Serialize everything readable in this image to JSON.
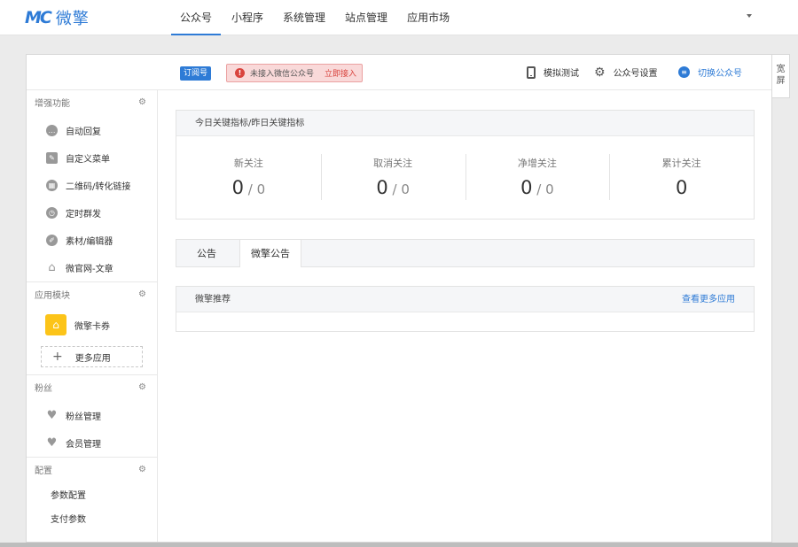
{
  "header": {
    "logo_mark": "MC",
    "logo_text": "微擎",
    "nav": [
      "公众号",
      "小程序",
      "系统管理",
      "站点管理",
      "应用市场"
    ]
  },
  "toolbar": {
    "badge": "订阅号",
    "alert_text": "未接入微信公众号",
    "alert_link": "立即接入",
    "simulate": "模拟测试",
    "settings": "公众号设置",
    "switch": "切换公众号"
  },
  "wide_tab": {
    "line1": "宽",
    "line2": "屏"
  },
  "sidebar": {
    "sections": [
      {
        "title": "增强功能",
        "items": [
          "自动回复",
          "自定义菜单",
          "二维码/转化链接",
          "定时群发",
          "素材/编辑器",
          "微官网-文章"
        ]
      },
      {
        "title": "应用模块",
        "card": "微擎卡券",
        "more": "更多应用"
      },
      {
        "title": "粉丝",
        "items": [
          "粉丝管理",
          "会员管理"
        ]
      },
      {
        "title": "配置",
        "items": [
          "参数配置",
          "支付参数"
        ]
      }
    ]
  },
  "stats_panel": {
    "title": "今日关键指标/昨日关键指标",
    "stats": [
      {
        "label": "新关注",
        "today": "0",
        "yesterday": "0"
      },
      {
        "label": "取消关注",
        "today": "0",
        "yesterday": "0"
      },
      {
        "label": "净增关注",
        "today": "0",
        "yesterday": "0"
      },
      {
        "label": "累计关注",
        "value": "0"
      }
    ]
  },
  "tabs": [
    "公告",
    "微擎公告"
  ],
  "recommend": {
    "title": "微擎推荐",
    "link": "查看更多应用"
  }
}
